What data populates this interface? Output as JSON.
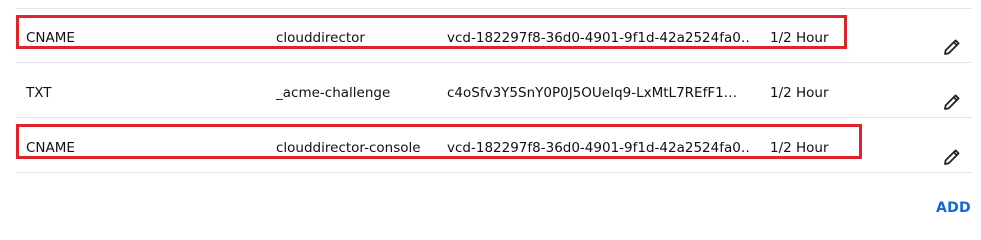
{
  "records": [
    {
      "type": "CNAME",
      "name": "clouddirector",
      "value": "vcd-182297f8-36d0-4901-9f1d-42a2524fa0…",
      "ttl": "1/2 Hour",
      "highlighted": true
    },
    {
      "type": "TXT",
      "name": "_acme-challenge",
      "value": "c4oSfv3Y5SnY0P0J5OUeIq9-LxMtL7REfF1…",
      "ttl": "1/2 Hour",
      "highlighted": false
    },
    {
      "type": "CNAME",
      "name": "clouddirector-console",
      "value": "vcd-182297f8-36d0-4901-9f1d-42a2524fa0…",
      "ttl": "1/2 Hour",
      "highlighted": true
    }
  ],
  "actions": {
    "add_label": "ADD"
  },
  "icons": {
    "edit": "pencil-icon"
  },
  "colors": {
    "highlight": "#e0242e",
    "accent": "#1468d4",
    "divider": "#e3e3e3"
  }
}
